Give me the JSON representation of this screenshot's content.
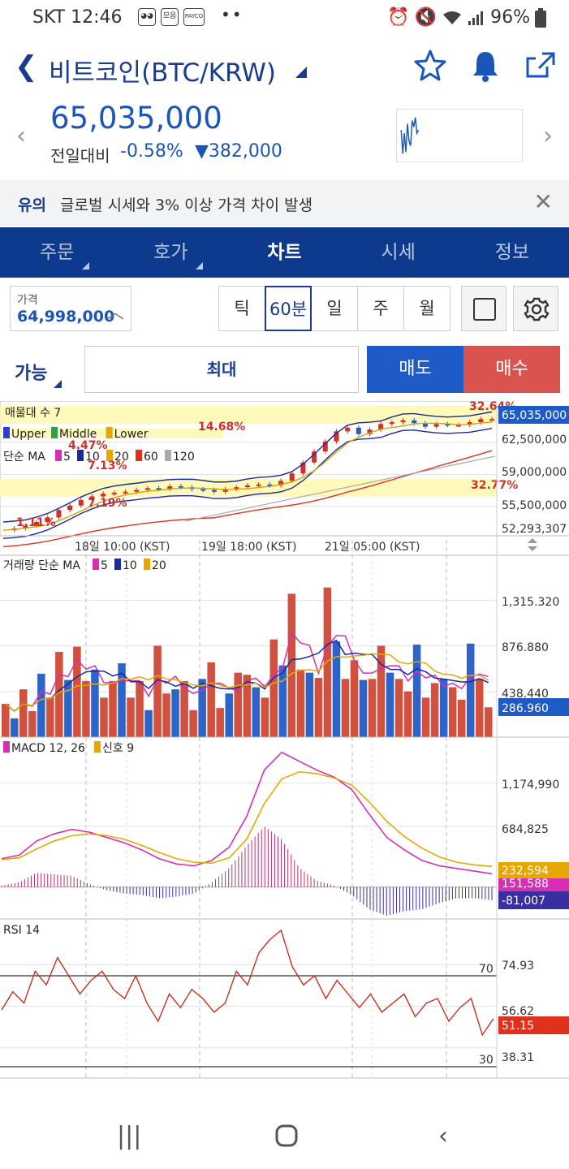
{
  "status": {
    "carrier_time": "SKT 12:46",
    "battery": "96%",
    "app_icons": [
      "모음",
      "PAYCO"
    ]
  },
  "header": {
    "title": "비트코인(BTC/KRW)"
  },
  "ticker": {
    "price": "65,035,000",
    "change_label": "전일대비",
    "change_pct": "-0.58%",
    "change_abs": "382,000"
  },
  "notice": {
    "tag": "유의",
    "message": "글로벌 시세와 3% 이상 가격 차이 발생"
  },
  "tabs": [
    {
      "label": "주문",
      "active": false
    },
    {
      "label": "호가",
      "active": false
    },
    {
      "label": "차트",
      "active": true
    },
    {
      "label": "시세",
      "active": false
    },
    {
      "label": "정보",
      "active": false
    }
  ],
  "controls": {
    "price_label": "가격",
    "price_value": "64,998,000",
    "periods": [
      "틱",
      "60분",
      "일",
      "주",
      "월"
    ],
    "selected_period": "60분"
  },
  "order": {
    "available_label": "가능",
    "max_label": "최대",
    "sell_label": "매도",
    "buy_label": "매수"
  },
  "chart_data": [
    {
      "type": "candlestick",
      "panel": "price",
      "legend": {
        "volume_profile": "매물대 수 7",
        "bollinger": [
          "Upper",
          "Middle",
          "Lower"
        ],
        "ma_title": "단순 MA",
        "ma_periods": [
          "5",
          "10",
          "20",
          "60",
          "120"
        ]
      },
      "y_ticks": [
        "65,035,000",
        "62,500,000",
        "59,000,000",
        "55,500,000",
        "52,293,307"
      ],
      "ylim": [
        52293307,
        66300000
      ],
      "current_price": "65,035,000",
      "x_ticks": [
        "18일 10:00 (KST)",
        "19일 18:00 (KST)",
        "21일 05:00 (KST)"
      ],
      "profile_labels": [
        "32.64%",
        "14.68%",
        "4.47%",
        "7.13%",
        "7.19%",
        "32.77%",
        "1.11%"
      ],
      "close": [
        52900000,
        53100000,
        53400000,
        53800000,
        54300000,
        55100000,
        55600000,
        56200000,
        56600000,
        56900000,
        57000000,
        57100000,
        57300000,
        57500000,
        57400000,
        57700000,
        57600000,
        57400000,
        57300000,
        57100000,
        57400000,
        57600000,
        57800000,
        57900000,
        57800000,
        58300000,
        59100000,
        60300000,
        61500000,
        62600000,
        63700000,
        64100000,
        63400000,
        63900000,
        64500000,
        64700000,
        64900000,
        64600000,
        64200000,
        64500000,
        64400000,
        64400000,
        64700000,
        65035000,
        65035000
      ]
    },
    {
      "type": "bar",
      "panel": "volume",
      "title": "거래량 단순 MA",
      "ma_periods": [
        "5",
        "10",
        "20"
      ],
      "y_ticks": [
        "1,315.320",
        "876.880",
        "438.440"
      ],
      "current_value": "286.960",
      "values": [
        320,
        180,
        460,
        250,
        610,
        380,
        820,
        550,
        870,
        540,
        650,
        380,
        540,
        710,
        380,
        540,
        260,
        880,
        420,
        460,
        540,
        260,
        560,
        720,
        280,
        420,
        620,
        600,
        480,
        380,
        940,
        690,
        1380,
        650,
        620,
        570,
        1440,
        920,
        560,
        740,
        550,
        560,
        880,
        620,
        560,
        440,
        890,
        380,
        520,
        560,
        480,
        360,
        900,
        560,
        287
      ],
      "ylim": [
        0,
        1750
      ]
    },
    {
      "type": "line",
      "panel": "macd",
      "title": "MACD 12, 26",
      "signal_label": "신호 9",
      "y_ticks": [
        "1,174,990",
        "684,825"
      ],
      "macd_value": "232,594",
      "signal_value": "151,588",
      "hist_value": "-81,007",
      "macd": [
        320000,
        360000,
        520000,
        600000,
        650000,
        620000,
        560000,
        500000,
        420000,
        320000,
        260000,
        240000,
        300000,
        450000,
        800000,
        1320000,
        1520000,
        1420000,
        1320000,
        1240000,
        1100000,
        820000,
        560000,
        420000,
        300000,
        240000,
        210000,
        180000,
        150000
      ],
      "signal": [
        310000,
        330000,
        430000,
        520000,
        580000,
        600000,
        580000,
        540000,
        470000,
        390000,
        320000,
        280000,
        270000,
        330000,
        540000,
        940000,
        1220000,
        1300000,
        1280000,
        1230000,
        1150000,
        960000,
        740000,
        570000,
        440000,
        340000,
        280000,
        250000,
        232594
      ],
      "ylim": [
        -250000,
        1600000
      ]
    },
    {
      "type": "line",
      "panel": "rsi",
      "title": "RSI 14",
      "y_ticks": [
        "74.93",
        "56.62",
        "38.31"
      ],
      "levels": [
        "70",
        "30"
      ],
      "current_value": "51.15",
      "values": [
        55,
        63,
        58,
        72,
        66,
        78,
        70,
        62,
        68,
        72,
        64,
        60,
        70,
        58,
        50,
        62,
        56,
        64,
        60,
        54,
        58,
        72,
        66,
        80,
        86,
        90,
        74,
        66,
        70,
        60,
        68,
        62,
        56,
        62,
        54,
        58,
        62,
        52,
        58,
        60,
        50,
        56,
        60,
        44,
        51.15
      ],
      "ylim": [
        25,
        95
      ]
    }
  ],
  "bottom_nav": [
    "recents",
    "home",
    "back"
  ]
}
